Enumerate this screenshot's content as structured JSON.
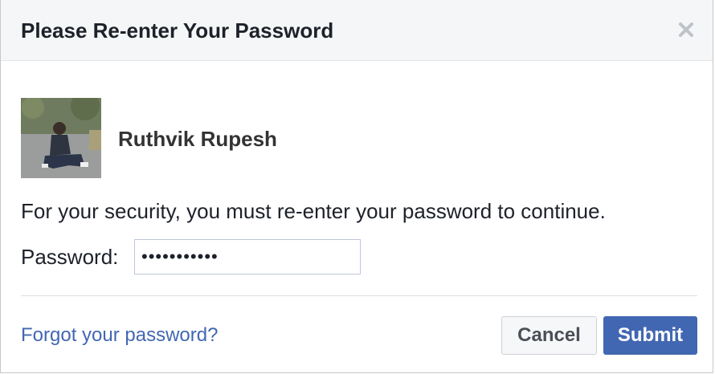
{
  "dialog": {
    "title": "Please Re-enter Your Password",
    "close_icon": "close-icon"
  },
  "user": {
    "name": "Ruthvik Rupesh",
    "avatar_icon": "avatar-photo"
  },
  "message": "For your security, you must re-enter your password to continue.",
  "password": {
    "label": "Password:",
    "value": "•••••••••••"
  },
  "footer": {
    "forgot_link": "Forgot your password?",
    "cancel_label": "Cancel",
    "submit_label": "Submit"
  },
  "colors": {
    "accent": "#4267b2",
    "header_bg": "#f5f6f7",
    "text": "#1d2129"
  }
}
